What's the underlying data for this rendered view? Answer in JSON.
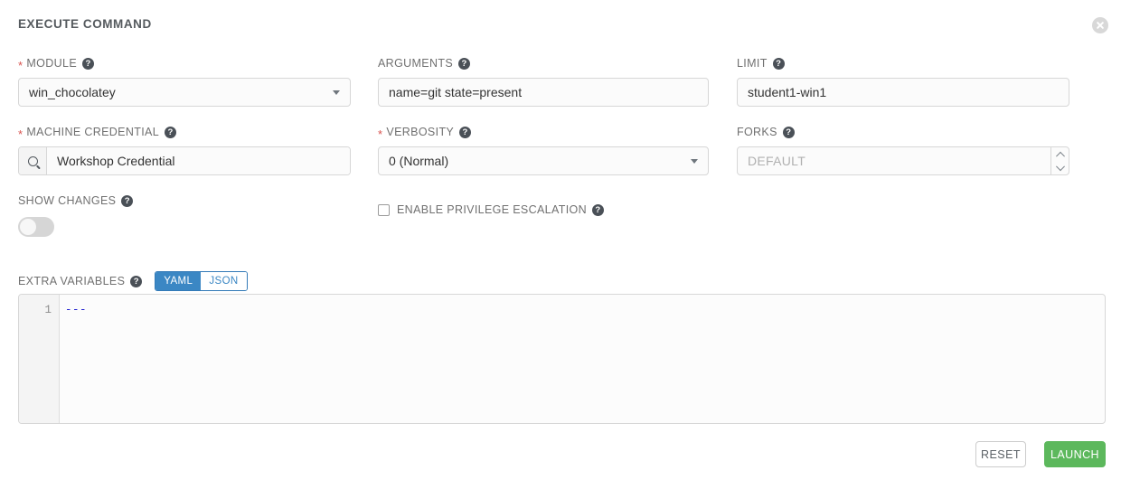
{
  "header": {
    "title": "EXECUTE COMMAND",
    "close_icon": "close-circle-icon"
  },
  "fields": {
    "module": {
      "label": "MODULE",
      "required": true,
      "value": "win_chocolatey",
      "control": "select",
      "help_icon": "?"
    },
    "arguments": {
      "label": "ARGUMENTS",
      "required": false,
      "value": "name=git state=present",
      "control": "text",
      "help_icon": "?"
    },
    "limit": {
      "label": "LIMIT",
      "required": false,
      "value": "student1-win1",
      "control": "text",
      "help_icon": "?"
    },
    "machine_credential": {
      "label": "MACHINE CREDENTIAL",
      "required": true,
      "value": "Workshop Credential",
      "control": "lookup",
      "icon": "search-icon",
      "help_icon": "?"
    },
    "verbosity": {
      "label": "VERBOSITY",
      "required": true,
      "value": "0 (Normal)",
      "control": "select",
      "help_icon": "?"
    },
    "forks": {
      "label": "FORKS",
      "required": false,
      "value": "",
      "placeholder": "DEFAULT",
      "control": "number",
      "help_icon": "?"
    },
    "show_changes": {
      "label": "SHOW CHANGES",
      "control": "toggle",
      "state": "off",
      "help_icon": "?"
    },
    "enable_privilege_escalation": {
      "label": "ENABLE PRIVILEGE ESCALATION",
      "control": "checkbox",
      "checked": false,
      "help_icon": "?"
    },
    "extra_variables": {
      "label": "EXTRA VARIABLES",
      "help_icon": "?",
      "format_options": [
        "YAML",
        "JSON"
      ],
      "selected_format": "YAML",
      "yaml_label": "YAML",
      "json_label": "JSON",
      "line_number": "1",
      "content": "---"
    }
  },
  "footer": {
    "reset_label": "RESET",
    "launch_label": "LAUNCH"
  },
  "colors": {
    "accent_blue": "#3b87c4",
    "launch_green": "#5cb85c",
    "required_red": "#d9534f",
    "label_grey": "#707070",
    "code_blue": "#2020d0"
  }
}
